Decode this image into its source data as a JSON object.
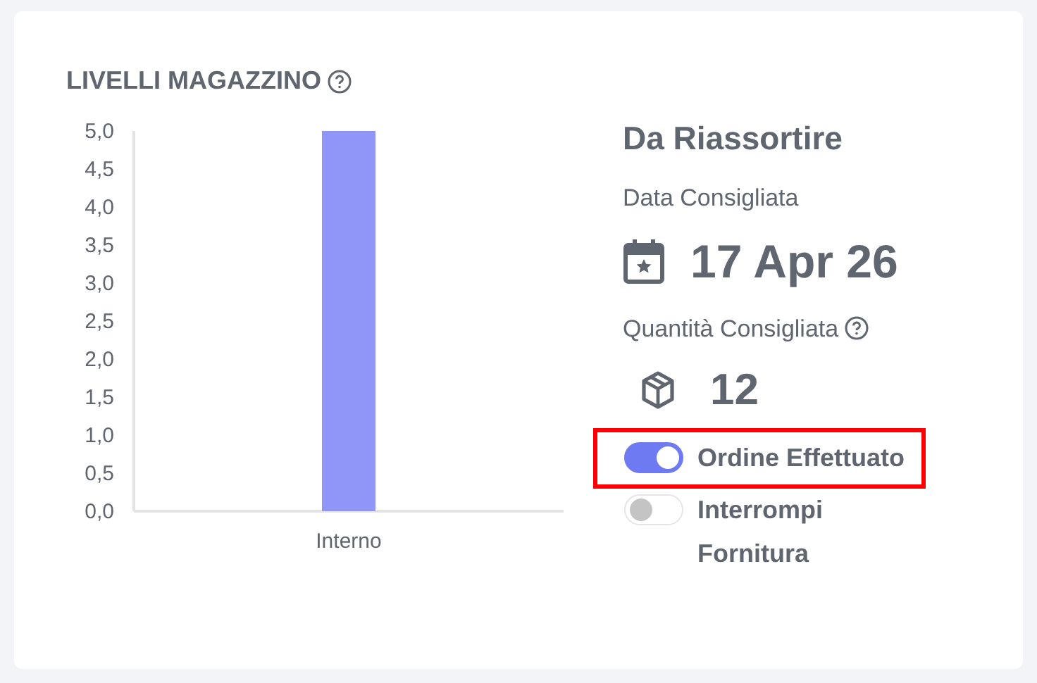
{
  "panel": {
    "title": "LIVELLI MAGAZZINO",
    "chart_data": {
      "type": "bar",
      "categories": [
        "Interno"
      ],
      "series": [
        {
          "color": "#8f96f7",
          "values": [
            5.0
          ]
        }
      ],
      "ylim": [
        0,
        5
      ],
      "yticks": [
        {
          "value": 0,
          "label": "0,0"
        },
        {
          "value": 0.5,
          "label": "0,5"
        },
        {
          "value": 1,
          "label": "1,0"
        },
        {
          "value": 1.5,
          "label": "1,5"
        },
        {
          "value": 2,
          "label": "2,0"
        },
        {
          "value": 2.5,
          "label": "2,5"
        },
        {
          "value": 3,
          "label": "3,0"
        },
        {
          "value": 3.5,
          "label": "3,5"
        },
        {
          "value": 4,
          "label": "4,0"
        },
        {
          "value": 4.5,
          "label": "4,5"
        },
        {
          "value": 5,
          "label": "5,0"
        }
      ]
    }
  },
  "restock": {
    "heading": "Da Riassortire",
    "date_label": "Data Consigliata",
    "date": "17 Apr 26",
    "quantity_label": "Quantità Consigliata",
    "quantity": "12",
    "toggles": [
      {
        "label": "Ordine Effettuato",
        "on": true,
        "highlighted": true
      },
      {
        "label": "Interrompi Fornitura",
        "on": false,
        "highlighted": false
      }
    ]
  }
}
